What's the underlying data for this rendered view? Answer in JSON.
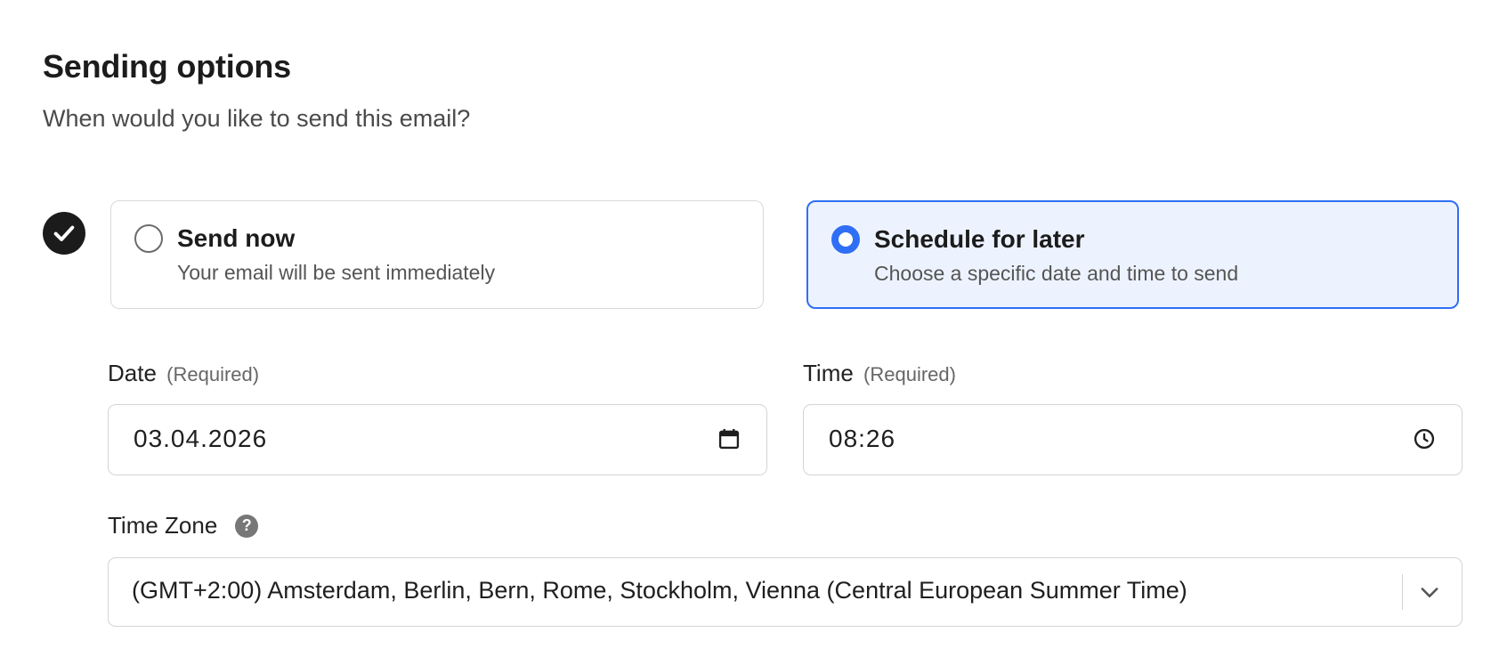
{
  "section": {
    "title": "Sending options",
    "subtitle": "When would you like to send this email?"
  },
  "options": [
    {
      "title": "Send now",
      "description": "Your email will be sent immediately",
      "selected": false
    },
    {
      "title": "Schedule for later",
      "description": "Choose a specific date and time to send",
      "selected": true
    }
  ],
  "date_field": {
    "label": "Date",
    "required_text": "(Required)",
    "value": "03.04.2026",
    "icon": "calendar-icon"
  },
  "time_field": {
    "label": "Time",
    "required_text": "(Required)",
    "value": "08:26",
    "icon": "clock-icon"
  },
  "timezone_field": {
    "label": "Time Zone",
    "help_glyph": "?",
    "value": "(GMT+2:00) Amsterdam, Berlin, Bern, Rome, Stockholm, Vienna (Central European Summer Time)",
    "icon": "chevron-down-icon"
  },
  "colors": {
    "accent": "#2f6ff5",
    "selected_background": "#edf3fe",
    "border": "#d4d4d4",
    "step_check": "#1b1b1b"
  }
}
